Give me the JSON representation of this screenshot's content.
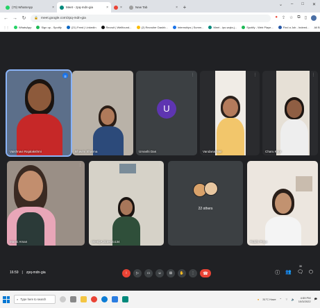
{
  "browser": {
    "tabs": [
      {
        "title": "(70) WhatsApp",
        "color": "#25d366",
        "active": false
      },
      {
        "title": "Meet - zpq-mdn-gia",
        "color": "#00897b",
        "active": true
      },
      {
        "title": "",
        "color": "#ea4335",
        "active": false
      },
      {
        "title": "New Tab",
        "color": "#9e9e9e",
        "active": false
      }
    ],
    "window_controls": [
      "⌄",
      "–",
      "□",
      "✕"
    ],
    "url": "meet.google.com/zpq-mdn-gia",
    "bookmarks": [
      {
        "label": "WhatsApp",
        "color": "#25d366"
      },
      {
        "label": "Sign up - Spotify",
        "color": "#1db954"
      },
      {
        "label": "(21) Feed | LinkedIn",
        "color": "#0a66c2"
      },
      {
        "label": "Recruit | Wellfound...",
        "color": "#111111"
      },
      {
        "label": "(2) Recruiter Dashb...",
        "color": "#fbbc05"
      },
      {
        "label": "Internships | Summ...",
        "color": "#1a73e8"
      },
      {
        "label": "Meet - ipo-wqkx-j...",
        "color": "#00897b"
      },
      {
        "label": "Spotify - Web Playe...",
        "color": "#1db954"
      },
      {
        "label": "Find a Job - Indeed...",
        "color": "#2557a7"
      }
    ],
    "bookmarks_more": "All Bookm"
  },
  "participants": [
    {
      "name": "Vaishnavi Rajalakshmi",
      "kind": "video",
      "skin": "#8d5a3b",
      "hair": "#1b1410",
      "top": "#c62828",
      "bg": "#5c6f8a"
    },
    {
      "name": "Bhavini Sharma",
      "kind": "video",
      "skin": "#b07a5a",
      "hair": "#2a1d16",
      "top": "#2c4a7a",
      "bg": "#b9b2a8"
    },
    {
      "name": "Urvashi Das",
      "kind": "avatar",
      "initial": "U"
    },
    {
      "name": "Vandana Nair",
      "kind": "video",
      "skin": "#b47b5c",
      "hair": "#2b211c",
      "top": "#f2c66b",
      "bg": "#f0ece6"
    },
    {
      "name": "Charu Kaur",
      "kind": "video",
      "skin": "#8f5e43",
      "hair": "#1d1612",
      "top": "#eeeeee",
      "bg": "#e6e0d6"
    },
    {
      "name": "Mansi Aman",
      "kind": "video",
      "skin": "#c28e6e",
      "hair": "#3a2a22",
      "top": "#e8a6b8",
      "bg": "#9a8f86"
    },
    {
      "name": "ISHIQA 21tesdo134",
      "kind": "video",
      "skin": "#a8775a",
      "hair": "#1a1411",
      "top": "#2f4f3a",
      "bg": "#d6d2c8"
    },
    {
      "name": "22 others",
      "kind": "group"
    },
    {
      "name": "Riddhi Priya",
      "kind": "video",
      "skin": "#c29270",
      "hair": "#2a1f19",
      "top": "#f4f4f4",
      "bg": "#ece6df"
    }
  ],
  "meeting": {
    "time": "16:59",
    "code": "zpq-mdn-gia",
    "participants_count": "30"
  },
  "taskbar": {
    "search_placeholder": "Type here to search",
    "weather": "31°C Haze",
    "time": "4:59 PM",
    "date": "10/3/2022"
  }
}
